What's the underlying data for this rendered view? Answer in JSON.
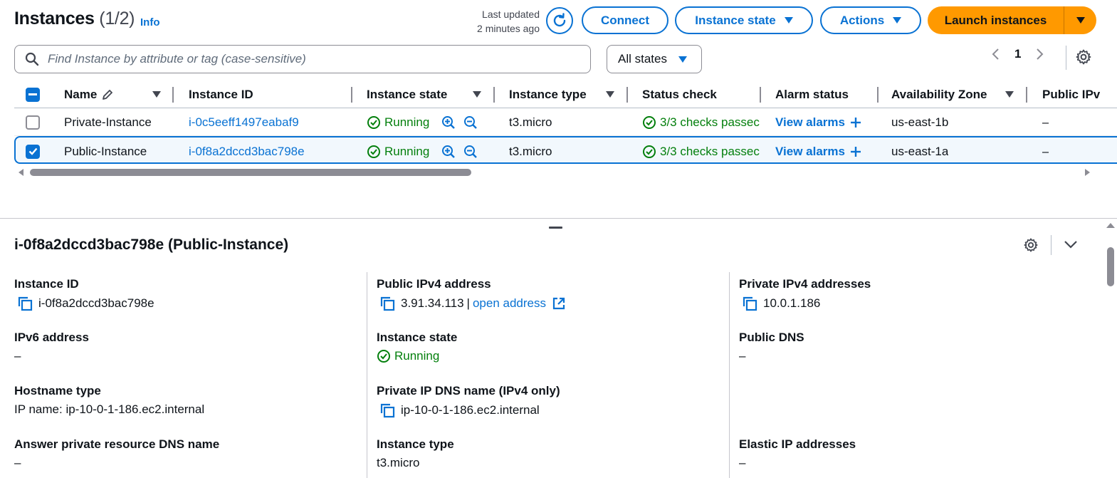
{
  "header": {
    "title": "Instances",
    "count": "(1/2)",
    "info": "Info",
    "last_updated_line1": "Last updated",
    "last_updated_line2": "2 minutes ago",
    "connect": "Connect",
    "instance_state": "Instance state",
    "actions": "Actions",
    "launch": "Launch instances"
  },
  "filters": {
    "search_placeholder": "Find Instance by attribute or tag (case-sensitive)",
    "states_selected": "All states",
    "page": "1"
  },
  "table": {
    "columns": [
      "Name",
      "Instance ID",
      "Instance state",
      "Instance type",
      "Status check",
      "Alarm status",
      "Availability Zone",
      "Public IPv"
    ],
    "rows": [
      {
        "selected": false,
        "name": "Private-Instance",
        "instance_id": "i-0c5eeff1497eabaf9",
        "state": "Running",
        "type": "t3.micro",
        "status_check": "3/3 checks passec",
        "alarm": "View alarms",
        "az": "us-east-1b",
        "public_ip": "–"
      },
      {
        "selected": true,
        "name": "Public-Instance",
        "instance_id": "i-0f8a2dccd3bac798e",
        "state": "Running",
        "type": "t3.micro",
        "status_check": "3/3 checks passec",
        "alarm": "View alarms",
        "az": "us-east-1a",
        "public_ip": "–"
      }
    ]
  },
  "details": {
    "title": "i-0f8a2dccd3bac798e (Public-Instance)",
    "col1": {
      "instance_id_label": "Instance ID",
      "instance_id": "i-0f8a2dccd3bac798e",
      "ipv6_label": "IPv6 address",
      "ipv6": "–",
      "hostname_type_label": "Hostname type",
      "hostname_type": "IP name: ip-10-0-1-186.ec2.internal",
      "answer_dns_label": "Answer private resource DNS name",
      "answer_dns": "–"
    },
    "col2": {
      "public_ipv4_label": "Public IPv4 address",
      "public_ipv4": "3.91.34.113",
      "separator": "|",
      "open_address": "open address",
      "state_label": "Instance state",
      "state": "Running",
      "private_dns_label": "Private IP DNS name (IPv4 only)",
      "private_dns": "ip-10-0-1-186.ec2.internal",
      "type_label": "Instance type",
      "type": "t3.micro"
    },
    "col3": {
      "private_ipv4_label": "Private IPv4 addresses",
      "private_ipv4": "10.0.1.186",
      "public_dns_label": "Public DNS",
      "public_dns": "–",
      "elastic_ip_label": "Elastic IP addresses",
      "elastic_ip": "–"
    }
  },
  "colors": {
    "accent": "#0972d3",
    "launch": "#ff9900",
    "success": "#037f0c"
  },
  "icons": [
    "refresh-icon",
    "search-icon",
    "gear-icon",
    "edit-icon",
    "zoom-in-icon",
    "zoom-out-icon",
    "plus-icon",
    "copy-icon",
    "external-link-icon",
    "check-circle-icon",
    "chevron-down-icon",
    "chevron-left-icon",
    "chevron-right-icon"
  ]
}
